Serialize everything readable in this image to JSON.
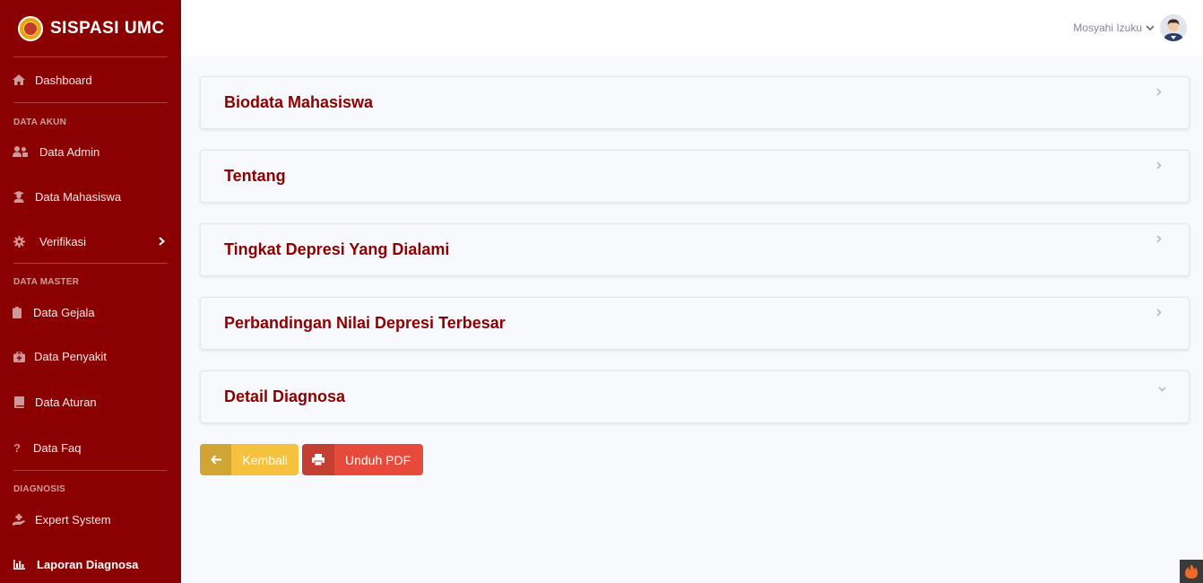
{
  "brand": {
    "title": "SISPASI UMC"
  },
  "sidebar": {
    "dashboard": "Dashboard",
    "heading_akun": "DATA AKUN",
    "data_admin": "Data Admin",
    "data_mahasiswa": "Data Mahasiswa",
    "verifikasi": "Verifikasi",
    "heading_master": "DATA MASTER",
    "data_gejala": "Data Gejala",
    "data_penyakit": "Data Penyakit",
    "data_aturan": "Data Aturan",
    "data_faq": "Data Faq",
    "heading_diagnosis": "DIAGNOSIS",
    "expert_system": "Expert System",
    "laporan_diagnosa": "Laporan Diagnosa"
  },
  "topbar": {
    "user_name": "Mosyahi Izuku"
  },
  "sections": [
    {
      "title": "Biodata Mahasiswa",
      "state": "collapsed"
    },
    {
      "title": "Tentang",
      "state": "collapsed"
    },
    {
      "title": "Tingkat Depresi Yang Dialami",
      "state": "collapsed"
    },
    {
      "title": "Perbandingan Nilai Depresi Terbesar",
      "state": "collapsed"
    },
    {
      "title": "Detail Diagnosa",
      "state": "expanded"
    }
  ],
  "buttons": {
    "back": "Kembali",
    "pdf": "Unduh PDF"
  },
  "colors": {
    "sidebar": "#8b0000",
    "accent": "#8b0000",
    "warning": "#f6c23e",
    "danger": "#e74a3b"
  }
}
